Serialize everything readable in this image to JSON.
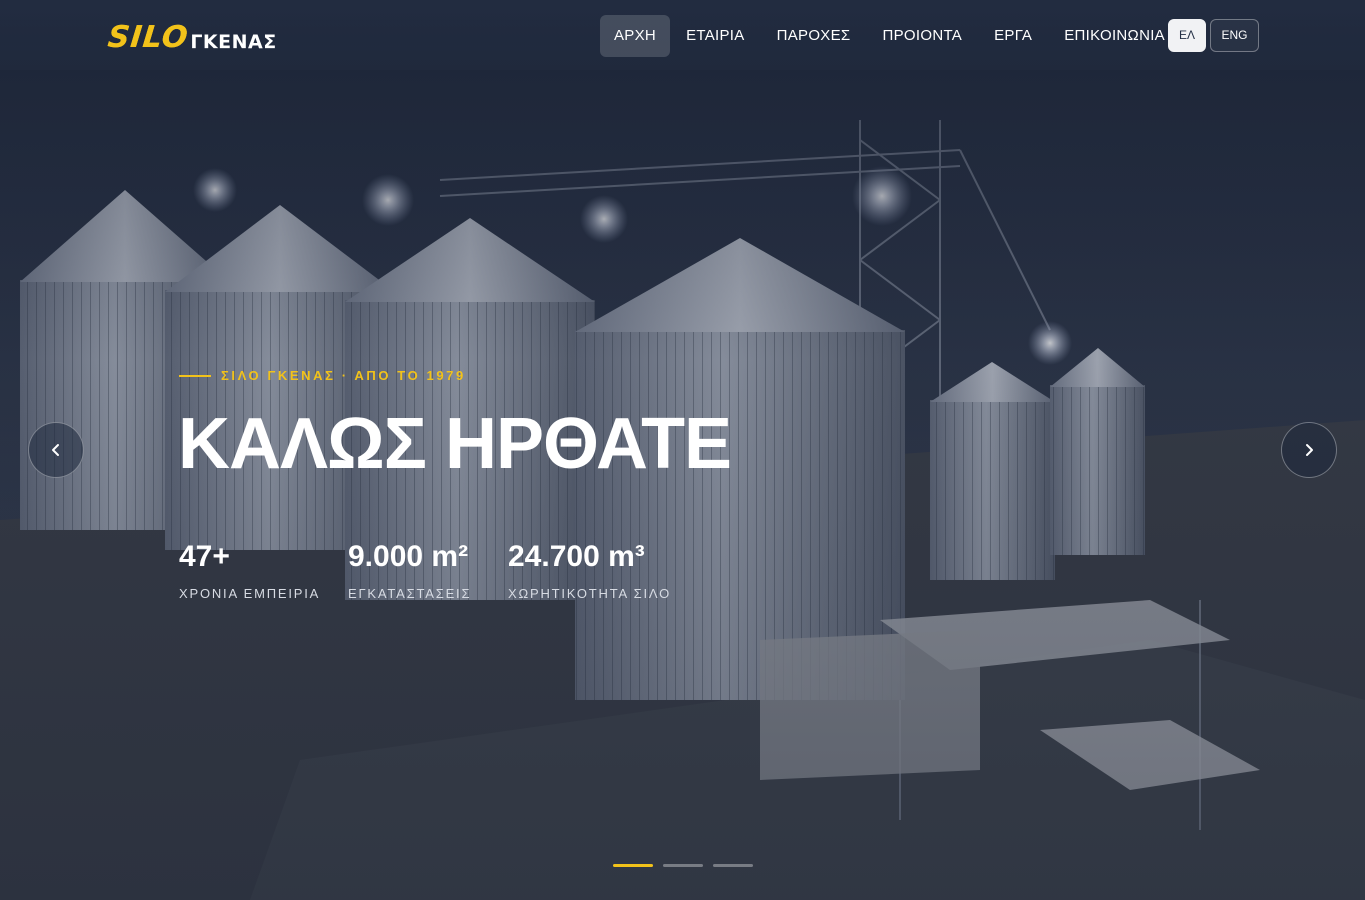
{
  "header": {
    "logo": {
      "primary": "SILO",
      "secondary": "ΓΚΕΝΑΣ"
    },
    "nav": [
      {
        "label": "ΑΡΧΗ",
        "active": true
      },
      {
        "label": "ΕΤΑΙΡΙΑ",
        "active": false
      },
      {
        "label": "ΠΑΡΟΧΕΣ",
        "active": false
      },
      {
        "label": "ΠΡΟΙΟΝΤΑ",
        "active": false
      },
      {
        "label": "ΕΡΓΑ",
        "active": false
      },
      {
        "label": "ΕΠΙΚΟΙΝΩΝΙΑ",
        "active": false
      }
    ],
    "languages": [
      {
        "label": "ΕΛ",
        "active": true
      },
      {
        "label": "ENG",
        "active": false
      }
    ]
  },
  "hero": {
    "eyebrow": "ΣΙΛΟ ΓΚΕΝΑΣ · ΑΠΟ ΤΟ 1979",
    "title": "ΚΑΛΩΣ ΗΡΘΑΤΕ",
    "stats": [
      {
        "value": "47+",
        "label": "ΧΡΟΝΙΑ ΕΜΠΕΙΡΙΑ"
      },
      {
        "value": "9.000 m²",
        "label": "ΕΓΚΑΤΑΣΤΑΣΕΙΣ"
      },
      {
        "value": "24.700 m³",
        "label": "ΧΩΡΗΤΙΚΟΤΗΤΑ ΣΙΛΟ"
      }
    ],
    "slides": {
      "count": 3,
      "active_index": 0
    },
    "prev_icon": "chevron-left-icon",
    "next_icon": "chevron-right-icon"
  },
  "colors": {
    "accent": "#f2c21a",
    "background": "#1c2536"
  }
}
